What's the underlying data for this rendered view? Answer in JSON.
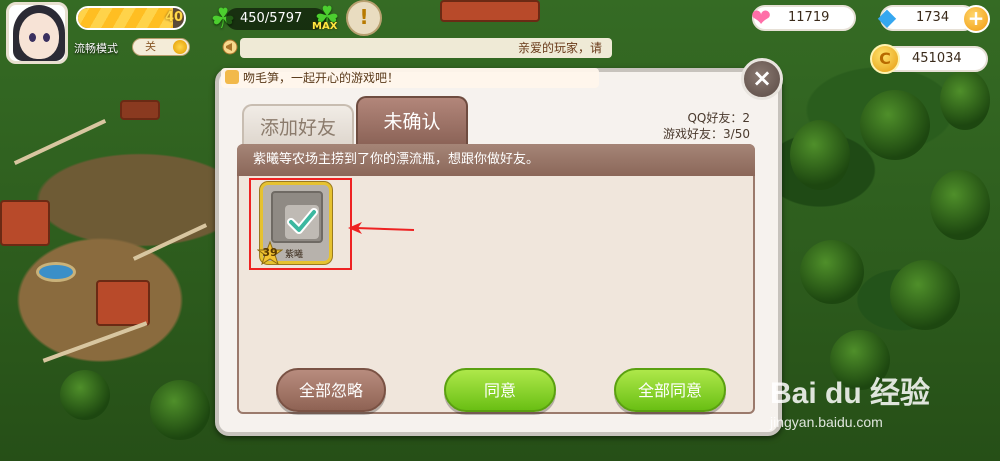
{
  "hud": {
    "level": "40",
    "xp_fraction": 0.9,
    "mode_label": "流畅模式",
    "mode_toggle": "关",
    "energy": "450/5797",
    "energy_max_tag": "MAX",
    "alert_icon": "exclamation-icon",
    "notice_text": "亲爱的玩家，请",
    "hearts": "11719",
    "diamonds": "1734",
    "coins": "451034"
  },
  "dialog": {
    "title": "吻毛笋，一起开心的游戏吧！",
    "close_label": "×",
    "tabs": {
      "add_friend": "添加好友",
      "pending": "未确认"
    },
    "friend_counts": {
      "qq": "QQ好友：2",
      "game": "游戏好友：3/50"
    },
    "message": "紫曦等农场主捞到了你的漂流瓶，想跟你做好友。",
    "request": {
      "level": "39",
      "name": "紫曦"
    },
    "buttons": {
      "ignore_all": "全部忽略",
      "agree": "同意",
      "agree_all": "全部同意"
    }
  },
  "watermark": {
    "brand": "Bai du 经验",
    "url": "jingyan.baidu.com"
  },
  "colors": {
    "highlight": "#ee2222",
    "green_button": "#6abf14",
    "brown_button": "#8f6354"
  }
}
